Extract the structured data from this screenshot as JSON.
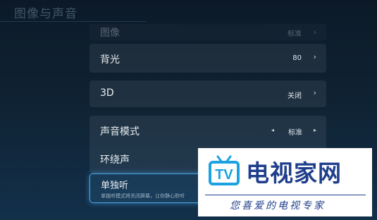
{
  "page": {
    "title": "图像与声音"
  },
  "menu": {
    "picture": {
      "label": "图像",
      "value": "标准"
    },
    "backlight": {
      "label": "背光",
      "value": "80"
    },
    "three_d": {
      "label": "3D",
      "value": "关闭"
    },
    "sound_mode": {
      "label": "声音模式",
      "value": "标准"
    },
    "surround": {
      "label": "环绕声"
    },
    "single_listen": {
      "label": "单独听",
      "description": "单独听模式将关闭屏幕，让你静心聆听"
    }
  },
  "watermark": {
    "brand": "电视家网",
    "logo_text": "TV",
    "slogan": "您喜爱的电视专家",
    "color": "#1f3f8c",
    "accent": "#1aa3e0"
  },
  "colors": {
    "focus_border": "#4aa6e8",
    "background_top": "#0c1a28",
    "background_bottom": "#13304a"
  }
}
